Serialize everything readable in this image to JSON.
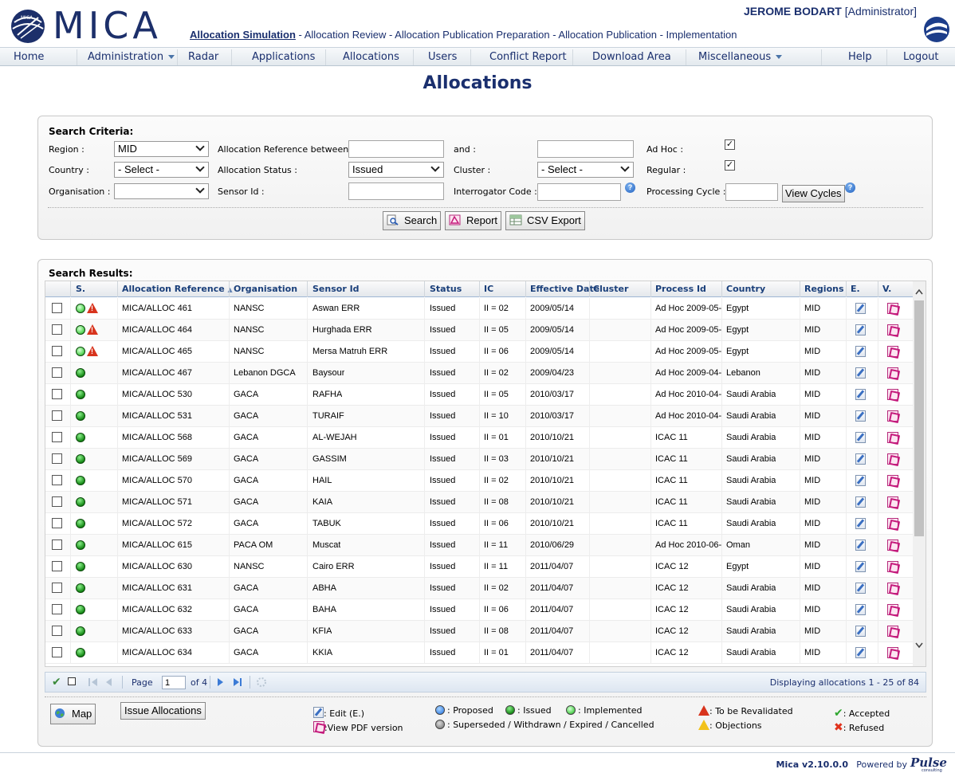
{
  "header": {
    "logo_text": "MICA",
    "user_name": "JEROME BODART",
    "user_role": "[Administrator]",
    "workflow": {
      "active": "Allocation Simulation",
      "rest": " - Allocation Review - Allocation Publication Preparation - Allocation Publication - Implementation"
    }
  },
  "nav": {
    "items": [
      "Home",
      "Administration",
      "Radar",
      "Applications",
      "Allocations",
      "Users",
      "Conflict Report",
      "Download Area",
      "Miscellaneous",
      "Help",
      "Logout"
    ]
  },
  "page_title": "Allocations",
  "criteria": {
    "title": "Search Criteria:",
    "region_label": "Region :",
    "region_value": "MID",
    "country_label": "Country :",
    "country_value": "- Select -",
    "organisation_label": "Organisation :",
    "organisation_value": "",
    "alloc_ref_label": "Allocation Reference between :",
    "alloc_status_label": "Allocation Status :",
    "alloc_status_value": "Issued",
    "sensor_label": "Sensor Id :",
    "and_label": "and :",
    "cluster_label": "Cluster :",
    "cluster_value": "- Select -",
    "interrogator_label": "Interrogator Code :",
    "adhoc_label": "Ad Hoc :",
    "regular_label": "Regular :",
    "processing_label": "Processing Cycle :",
    "view_cycles": "View Cycles",
    "search_btn": "Search",
    "report_btn": "Report",
    "csv_btn": "CSV Export"
  },
  "results": {
    "title": "Search Results:",
    "columns": [
      "S.",
      "Allocation Reference",
      "Organisation",
      "Sensor Id",
      "Status",
      "IC",
      "Effective Date",
      "Cluster",
      "Process Id",
      "Country",
      "Regions",
      "E.",
      "V."
    ],
    "rows": [
      {
        "ref": "MICA/ALLOC 461",
        "org": "NANSC",
        "sensor": "Aswan ERR",
        "status": "Issued",
        "ic": "II = 02",
        "date": "2009/05/14",
        "cluster": "",
        "process": "Ad Hoc 2009-05-",
        "country": "Egypt",
        "region": "MID",
        "state": "implemented",
        "warn": true
      },
      {
        "ref": "MICA/ALLOC 464",
        "org": "NANSC",
        "sensor": "Hurghada ERR",
        "status": "Issued",
        "ic": "II = 05",
        "date": "2009/05/14",
        "cluster": "",
        "process": "Ad Hoc 2009-05-",
        "country": "Egypt",
        "region": "MID",
        "state": "implemented",
        "warn": true
      },
      {
        "ref": "MICA/ALLOC 465",
        "org": "NANSC",
        "sensor": "Mersa Matruh ERR",
        "status": "Issued",
        "ic": "II = 06",
        "date": "2009/05/14",
        "cluster": "",
        "process": "Ad Hoc 2009-05-",
        "country": "Egypt",
        "region": "MID",
        "state": "implemented",
        "warn": true
      },
      {
        "ref": "MICA/ALLOC 467",
        "org": "Lebanon DGCA",
        "sensor": "Baysour",
        "status": "Issued",
        "ic": "II = 02",
        "date": "2009/04/23",
        "cluster": "",
        "process": "Ad Hoc 2009-04-",
        "country": "Lebanon",
        "region": "MID",
        "state": "issued",
        "warn": false
      },
      {
        "ref": "MICA/ALLOC 530",
        "org": "GACA",
        "sensor": "RAFHA",
        "status": "Issued",
        "ic": "II = 05",
        "date": "2010/03/17",
        "cluster": "",
        "process": "Ad Hoc 2010-04-",
        "country": "Saudi Arabia",
        "region": "MID",
        "state": "issued",
        "warn": false
      },
      {
        "ref": "MICA/ALLOC 531",
        "org": "GACA",
        "sensor": "TURAIF",
        "status": "Issued",
        "ic": "II = 10",
        "date": "2010/03/17",
        "cluster": "",
        "process": "Ad Hoc 2010-04-",
        "country": "Saudi Arabia",
        "region": "MID",
        "state": "issued",
        "warn": false
      },
      {
        "ref": "MICA/ALLOC 568",
        "org": "GACA",
        "sensor": "AL-WEJAH",
        "status": "Issued",
        "ic": "II = 01",
        "date": "2010/10/21",
        "cluster": "",
        "process": "ICAC 11",
        "country": "Saudi Arabia",
        "region": "MID",
        "state": "issued",
        "warn": false
      },
      {
        "ref": "MICA/ALLOC 569",
        "org": "GACA",
        "sensor": "GASSIM",
        "status": "Issued",
        "ic": "II = 03",
        "date": "2010/10/21",
        "cluster": "",
        "process": "ICAC 11",
        "country": "Saudi Arabia",
        "region": "MID",
        "state": "issued",
        "warn": false
      },
      {
        "ref": "MICA/ALLOC 570",
        "org": "GACA",
        "sensor": "HAIL",
        "status": "Issued",
        "ic": "II = 02",
        "date": "2010/10/21",
        "cluster": "",
        "process": "ICAC 11",
        "country": "Saudi Arabia",
        "region": "MID",
        "state": "issued",
        "warn": false
      },
      {
        "ref": "MICA/ALLOC 571",
        "org": "GACA",
        "sensor": "KAIA",
        "status": "Issued",
        "ic": "II = 08",
        "date": "2010/10/21",
        "cluster": "",
        "process": "ICAC 11",
        "country": "Saudi Arabia",
        "region": "MID",
        "state": "issued",
        "warn": false
      },
      {
        "ref": "MICA/ALLOC 572",
        "org": "GACA",
        "sensor": "TABUK",
        "status": "Issued",
        "ic": "II = 06",
        "date": "2010/10/21",
        "cluster": "",
        "process": "ICAC 11",
        "country": "Saudi Arabia",
        "region": "MID",
        "state": "issued",
        "warn": false
      },
      {
        "ref": "MICA/ALLOC 615",
        "org": "PACA OM",
        "sensor": "Muscat",
        "status": "Issued",
        "ic": "II = 11",
        "date": "2010/06/29",
        "cluster": "",
        "process": "Ad Hoc 2010-06-",
        "country": "Oman",
        "region": "MID",
        "state": "issued",
        "warn": false
      },
      {
        "ref": "MICA/ALLOC 630",
        "org": "NANSC",
        "sensor": "Cairo ERR",
        "status": "Issued",
        "ic": "II = 11",
        "date": "2011/04/07",
        "cluster": "",
        "process": "ICAC 12",
        "country": "Egypt",
        "region": "MID",
        "state": "issued",
        "warn": false
      },
      {
        "ref": "MICA/ALLOC 631",
        "org": "GACA",
        "sensor": "ABHA",
        "status": "Issued",
        "ic": "II = 02",
        "date": "2011/04/07",
        "cluster": "",
        "process": "ICAC 12",
        "country": "Saudi Arabia",
        "region": "MID",
        "state": "issued",
        "warn": false
      },
      {
        "ref": "MICA/ALLOC 632",
        "org": "GACA",
        "sensor": "BAHA",
        "status": "Issued",
        "ic": "II = 06",
        "date": "2011/04/07",
        "cluster": "",
        "process": "ICAC 12",
        "country": "Saudi Arabia",
        "region": "MID",
        "state": "issued",
        "warn": false
      },
      {
        "ref": "MICA/ALLOC 633",
        "org": "GACA",
        "sensor": "KFIA",
        "status": "Issued",
        "ic": "II = 08",
        "date": "2011/04/07",
        "cluster": "",
        "process": "ICAC 12",
        "country": "Saudi Arabia",
        "region": "MID",
        "state": "issued",
        "warn": false
      },
      {
        "ref": "MICA/ALLOC 634",
        "org": "GACA",
        "sensor": "KKIA",
        "status": "Issued",
        "ic": "II = 01",
        "date": "2011/04/07",
        "cluster": "",
        "process": "ICAC 12",
        "country": "Saudi Arabia",
        "region": "MID",
        "state": "issued",
        "warn": false
      }
    ],
    "pager": {
      "page_label": "Page",
      "page_value": "1",
      "of_label": "of 4",
      "display_text": "Displaying allocations 1 - 25 of 84"
    }
  },
  "legend": {
    "map_btn": "Map",
    "issue_btn": "Issue Allocations",
    "edit": ": Edit (E.)",
    "view_pdf": ":View PDF version",
    "proposed": ": Proposed",
    "issued": ": Issued",
    "implemented": ": Implemented",
    "superseded": ": Superseded / Withdrawn / Expired / Cancelled",
    "revalidate": ": To be Revalidated",
    "objections": ": Objections",
    "accepted": ": Accepted",
    "refused": ": Refused"
  },
  "footer": {
    "version": "Mica v2.10.0.0",
    "powered": "Powered by",
    "brand": "Pulse",
    "brand_sub": "consulting"
  },
  "colors": {
    "brand": "#1a2f6e",
    "issued": "#168a16",
    "implemented": "#5ed85e",
    "warning": "#d8341d"
  }
}
